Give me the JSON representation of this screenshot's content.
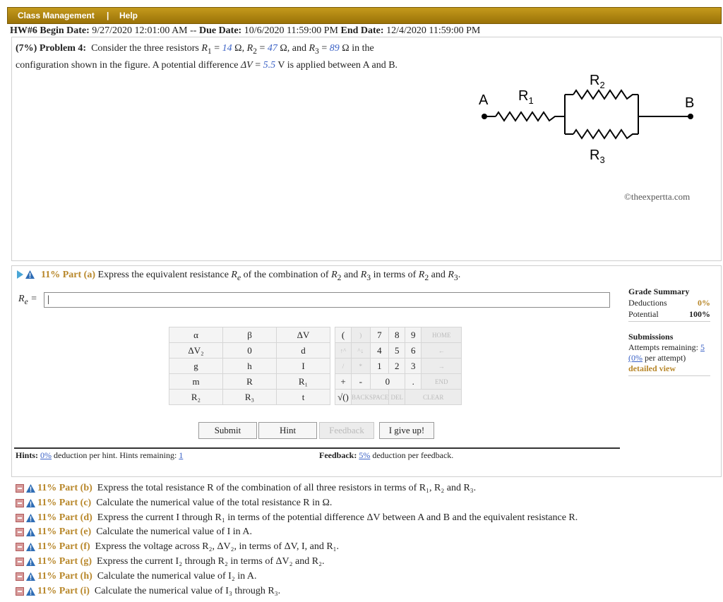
{
  "topbar": {
    "menu1": "Class Management",
    "sep": "|",
    "menu2": "Help"
  },
  "dates": {
    "hw": "HW#6",
    "begin_label": "Begin Date:",
    "begin_value": "9/27/2020 12:01:00 AM --",
    "due_label": "Due Date:",
    "due_value": "10/6/2020 11:59:00 PM",
    "end_label": "End Date:",
    "end_value": "12/4/2020 11:59:00 PM"
  },
  "problem": {
    "weight": "(7%)",
    "label": "Problem 4:",
    "text1": "Consider the three resistors",
    "r1_val": "14",
    "r2_val": "47",
    "r3_val": "89",
    "unit": "Ω",
    "text2": "in the",
    "text3": "configuration shown in the figure. A potential difference",
    "dv_val": "5.5",
    "text4": "V is applied between A and B."
  },
  "circuit": {
    "a": "A",
    "b": "B",
    "r1": "R1",
    "r2": "R2",
    "r3": "R3"
  },
  "copyright": "©theexpertta.com",
  "part_a": {
    "pct": "11% Part (a)",
    "text": "Express the equivalent resistance",
    "text2": "of the combination of",
    "text3": "and",
    "text4": "in terms of",
    "text5": "and",
    "answer_label": "R",
    "answer_value": "|"
  },
  "grade": {
    "title": "Grade Summary",
    "deductions_label": "Deductions",
    "deductions_value": "0%",
    "potential_label": "Potential",
    "potential_value": "100%",
    "submissions_title": "Submissions",
    "attempts_label": "Attempts remaining:",
    "attempts_value": "5",
    "per_attempt_value": "(0%",
    "per_attempt_label": "per attempt)",
    "detailed_view": "detailed view"
  },
  "keypad": {
    "symbols": [
      [
        "α",
        "β",
        "ΔV"
      ],
      [
        "ΔV₂",
        "0",
        "d"
      ],
      [
        "g",
        "h",
        "I"
      ],
      [
        "m",
        "R",
        "R₁"
      ],
      [
        "R₂",
        "R₃",
        "t"
      ]
    ],
    "nums": [
      [
        "(",
        ")",
        "7",
        "8",
        "9",
        "HOME"
      ],
      [
        "↑^",
        "^↓",
        "4",
        "5",
        "6",
        "←"
      ],
      [
        "/",
        "*",
        "1",
        "2",
        "3",
        "→"
      ],
      [
        "+",
        "-",
        "",
        "0",
        ".",
        "END"
      ],
      [
        "√()",
        "BACKSPACE",
        "",
        "DEL",
        "CLEAR",
        ""
      ]
    ]
  },
  "buttons": {
    "submit": "Submit",
    "hint": "Hint",
    "feedback": "Feedback",
    "give_up": "I give up!"
  },
  "hints": {
    "label": "Hints:",
    "pct": "0%",
    "text": "deduction per hint. Hints remaining:",
    "remaining": "1"
  },
  "feedback": {
    "label": "Feedback:",
    "pct": "5%",
    "text": "deduction per feedback."
  },
  "other_parts": [
    {
      "pct": "11% Part (b)",
      "text": "Express the total resistance R of the combination of all three resistors in terms of R₁, R₂ and R₃."
    },
    {
      "pct": "11% Part (c)",
      "text": "Calculate the numerical value of the total resistance R in Ω."
    },
    {
      "pct": "11% Part (d)",
      "text": "Express the current I through R₁ in terms of the potential difference ΔV between A and B and the equivalent resistance R."
    },
    {
      "pct": "11% Part (e)",
      "text": "Calculate the numerical value of I in A."
    },
    {
      "pct": "11% Part (f)",
      "text": "Express the voltage across R₂, ΔV₂, in terms of ΔV, I, and R₁."
    },
    {
      "pct": "11% Part (g)",
      "text": "Express the current I₂ through R₂ in terms of ΔV₂ and R₂."
    },
    {
      "pct": "11% Part (h)",
      "text": "Calculate the numerical value of I₂ in A."
    },
    {
      "pct": "11% Part (i)",
      "text": "Calculate the numerical value of I₃ through R₃."
    }
  ]
}
